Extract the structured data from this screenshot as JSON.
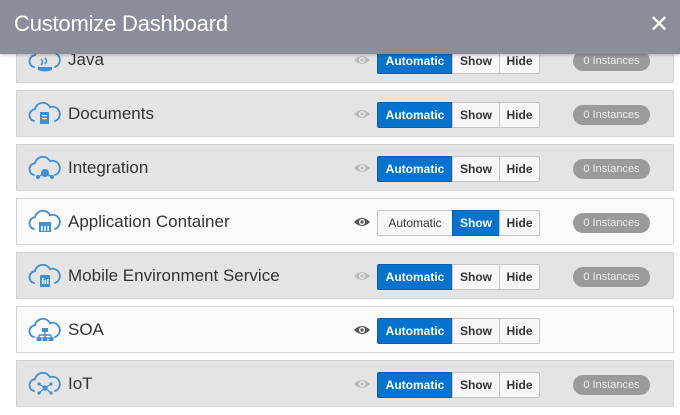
{
  "dialog": {
    "title": "Customize Dashboard",
    "close_glyph": "✕"
  },
  "options": {
    "automatic": "Automatic",
    "show": "Show",
    "hide": "Hide"
  },
  "colors": {
    "header": "#8a8e9a",
    "accent": "#0572ce",
    "icon": "#3e8fd6",
    "badge": "#9a9a9a"
  },
  "services": [
    {
      "name": "Java",
      "icon": "java-cloud-icon",
      "selected": "Automatic",
      "instances": "0 Instances",
      "shade": true
    },
    {
      "name": "Documents",
      "icon": "documents-cloud-icon",
      "selected": "Automatic",
      "instances": "0 Instances",
      "shade": true
    },
    {
      "name": "Integration",
      "icon": "integration-cloud-icon",
      "selected": "Automatic",
      "instances": "0 Instances",
      "shade": true
    },
    {
      "name": "Application Container",
      "icon": "application-container-cloud-icon",
      "selected": "Show",
      "instances": "0 Instances",
      "shade": false
    },
    {
      "name": "Mobile Environment Service",
      "icon": "mobile-environment-cloud-icon",
      "selected": "Automatic",
      "instances": "0 Instances",
      "shade": true
    },
    {
      "name": "SOA",
      "icon": "soa-cloud-icon",
      "selected": "Automatic",
      "instances": "",
      "shade": false
    },
    {
      "name": "IoT",
      "icon": "iot-cloud-icon",
      "selected": "Automatic",
      "instances": "0 Instances",
      "shade": true
    }
  ]
}
